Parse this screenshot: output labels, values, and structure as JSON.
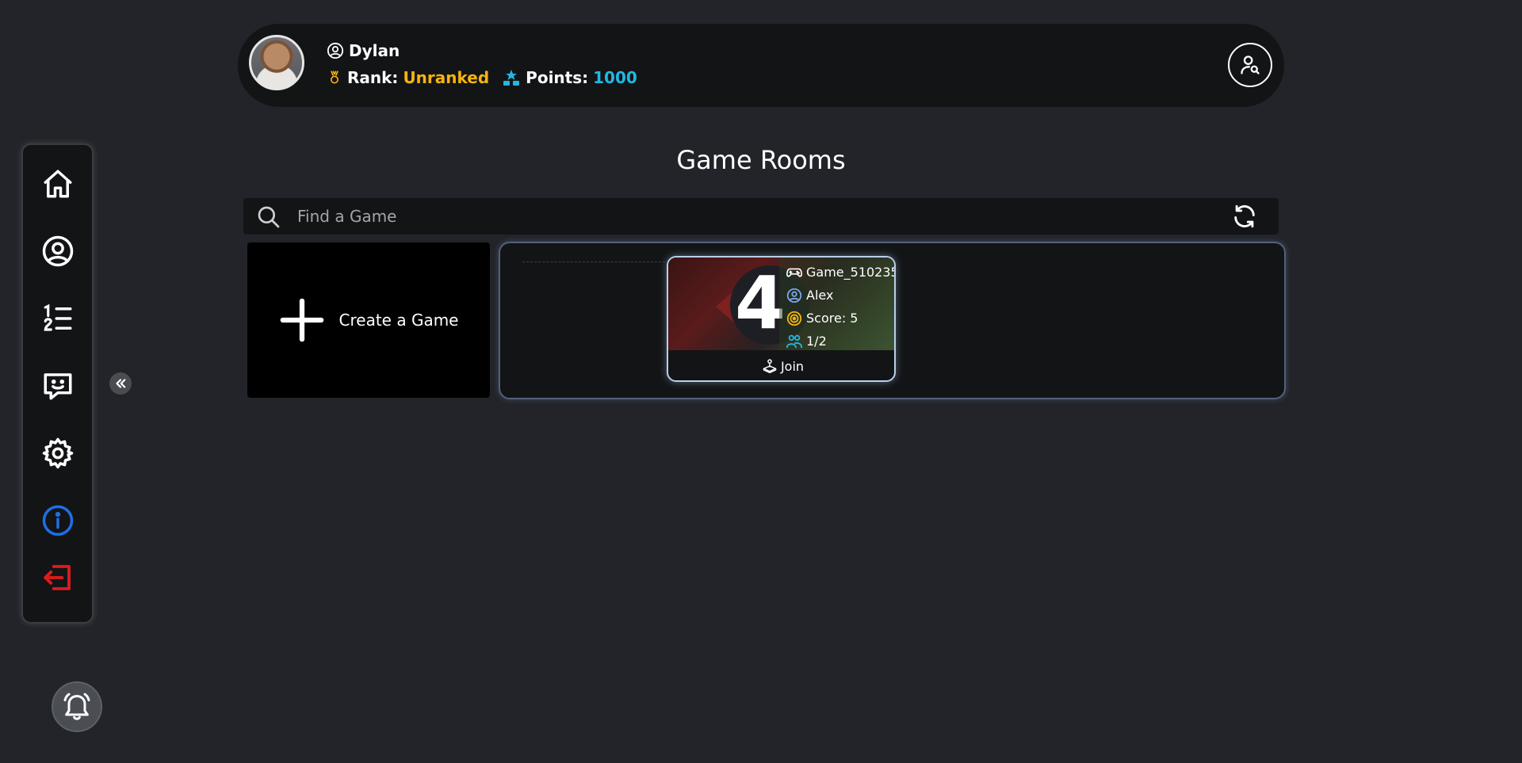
{
  "header": {
    "username": "Dylan",
    "rank_label": "Rank:",
    "rank_value": "Unranked",
    "points_label": "Points:",
    "points_value": "1000"
  },
  "page": {
    "title": "Game Rooms"
  },
  "search": {
    "placeholder": "Find a Game",
    "value": ""
  },
  "create_game": {
    "label": "Create a Game"
  },
  "rooms": [
    {
      "name": "Game_510235",
      "host": "Alex",
      "score": "Score: 5",
      "players": "1/2",
      "join_label": "Join",
      "thumbnail_glyph": "4"
    }
  ],
  "sidebar": {
    "items": [
      {
        "icon": "home-icon"
      },
      {
        "icon": "profile-icon"
      },
      {
        "icon": "leaderboard-icon"
      },
      {
        "icon": "chat-icon"
      },
      {
        "icon": "settings-icon"
      },
      {
        "icon": "info-icon"
      },
      {
        "icon": "logout-icon"
      }
    ]
  },
  "colors": {
    "background": "#222429",
    "panel": "#131416",
    "rank": "#f5b40f",
    "points": "#21b8e3",
    "info": "#1e6fe8",
    "logout": "#e01b1b"
  }
}
